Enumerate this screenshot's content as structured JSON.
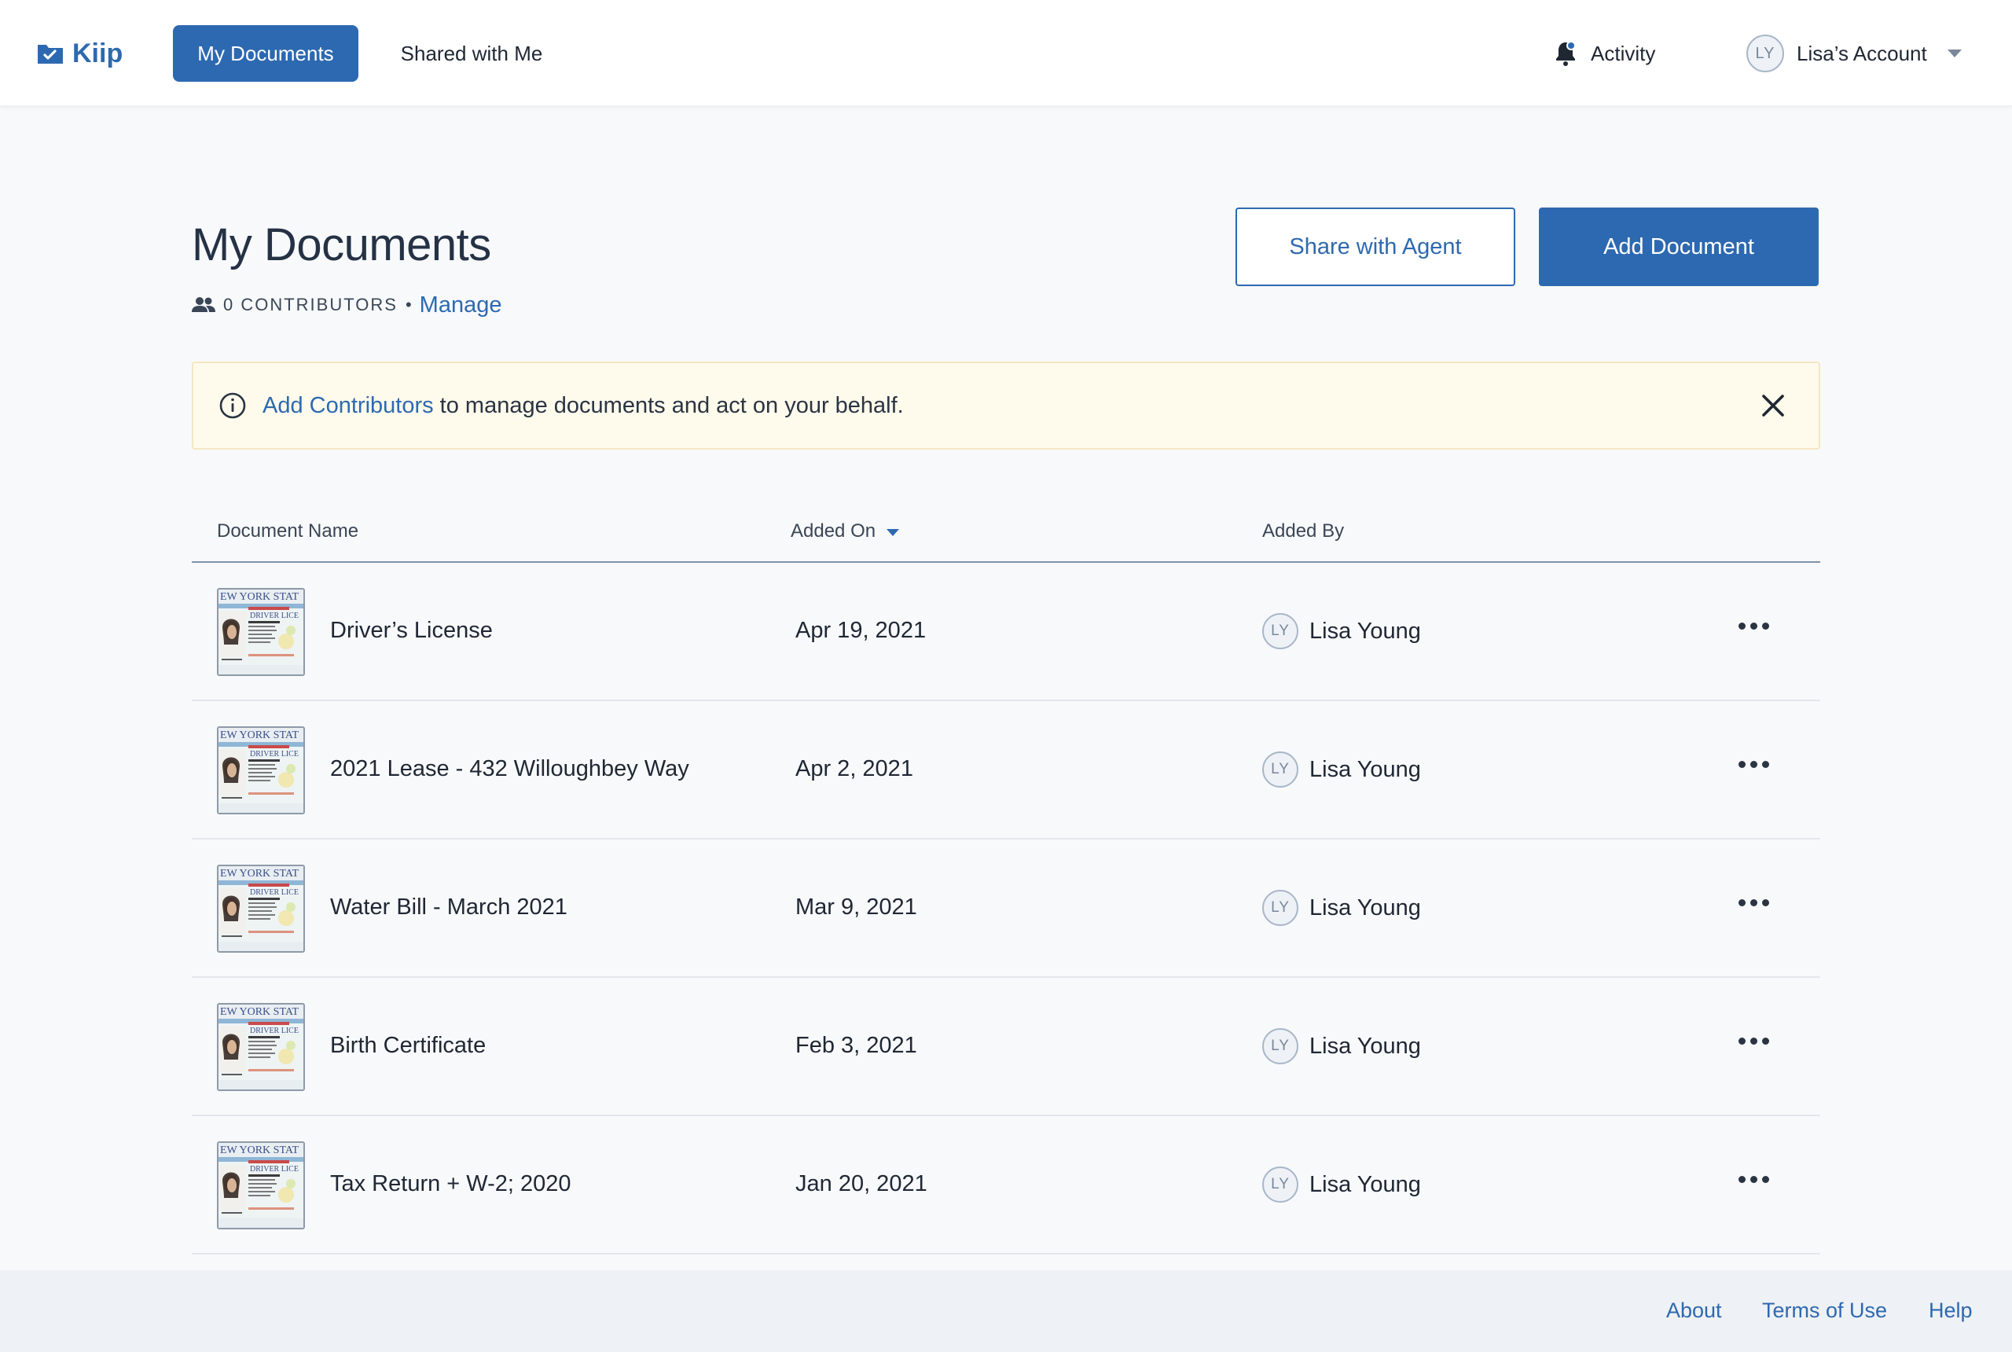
{
  "nav": {
    "brand": "Kiip",
    "tabs": [
      {
        "label": "My Documents",
        "active": true
      },
      {
        "label": "Shared with Me",
        "active": false
      }
    ],
    "activity_label": "Activity",
    "account": {
      "initials": "LY",
      "label": "Lisa’s Account"
    }
  },
  "header": {
    "title": "My Documents",
    "contributors_text": "0 CONTRIBUTORS",
    "separator": "•",
    "manage_label": "Manage",
    "share_button": "Share with Agent",
    "add_button": "Add Document"
  },
  "banner": {
    "link_text": "Add Contributors",
    "text": " to manage documents and act on your behalf."
  },
  "table": {
    "columns": {
      "name": "Document Name",
      "added_on": "Added On",
      "added_by": "Added By"
    },
    "rows": [
      {
        "name": "Driver’s License",
        "date": "Apr 19, 2021",
        "by_initials": "LY",
        "by": "Lisa Young"
      },
      {
        "name": "2021 Lease - 432 Willoughbey Way",
        "date": "Apr 2, 2021",
        "by_initials": "LY",
        "by": "Lisa Young"
      },
      {
        "name": "Water Bill - March 2021",
        "date": "Mar 9, 2021",
        "by_initials": "LY",
        "by": "Lisa Young"
      },
      {
        "name": "Birth Certificate",
        "date": "Feb 3, 2021",
        "by_initials": "LY",
        "by": "Lisa Young"
      },
      {
        "name": "Tax Return + W-2; 2020",
        "date": "Jan 20, 2021",
        "by_initials": "LY",
        "by": "Lisa Young"
      }
    ]
  },
  "footer": {
    "about": "About",
    "terms": "Terms of Use",
    "help": "Help"
  },
  "colors": {
    "accent": "#2d69b0",
    "banner_bg": "#fefaec",
    "page_bg": "#f8f9fb"
  },
  "icons": [
    "kiip-logo-icon",
    "bell-icon",
    "chevron-down-icon",
    "people-icon",
    "info-icon",
    "close-icon",
    "sort-down-icon",
    "more-horizontal-icon",
    "document-thumbnail"
  ]
}
